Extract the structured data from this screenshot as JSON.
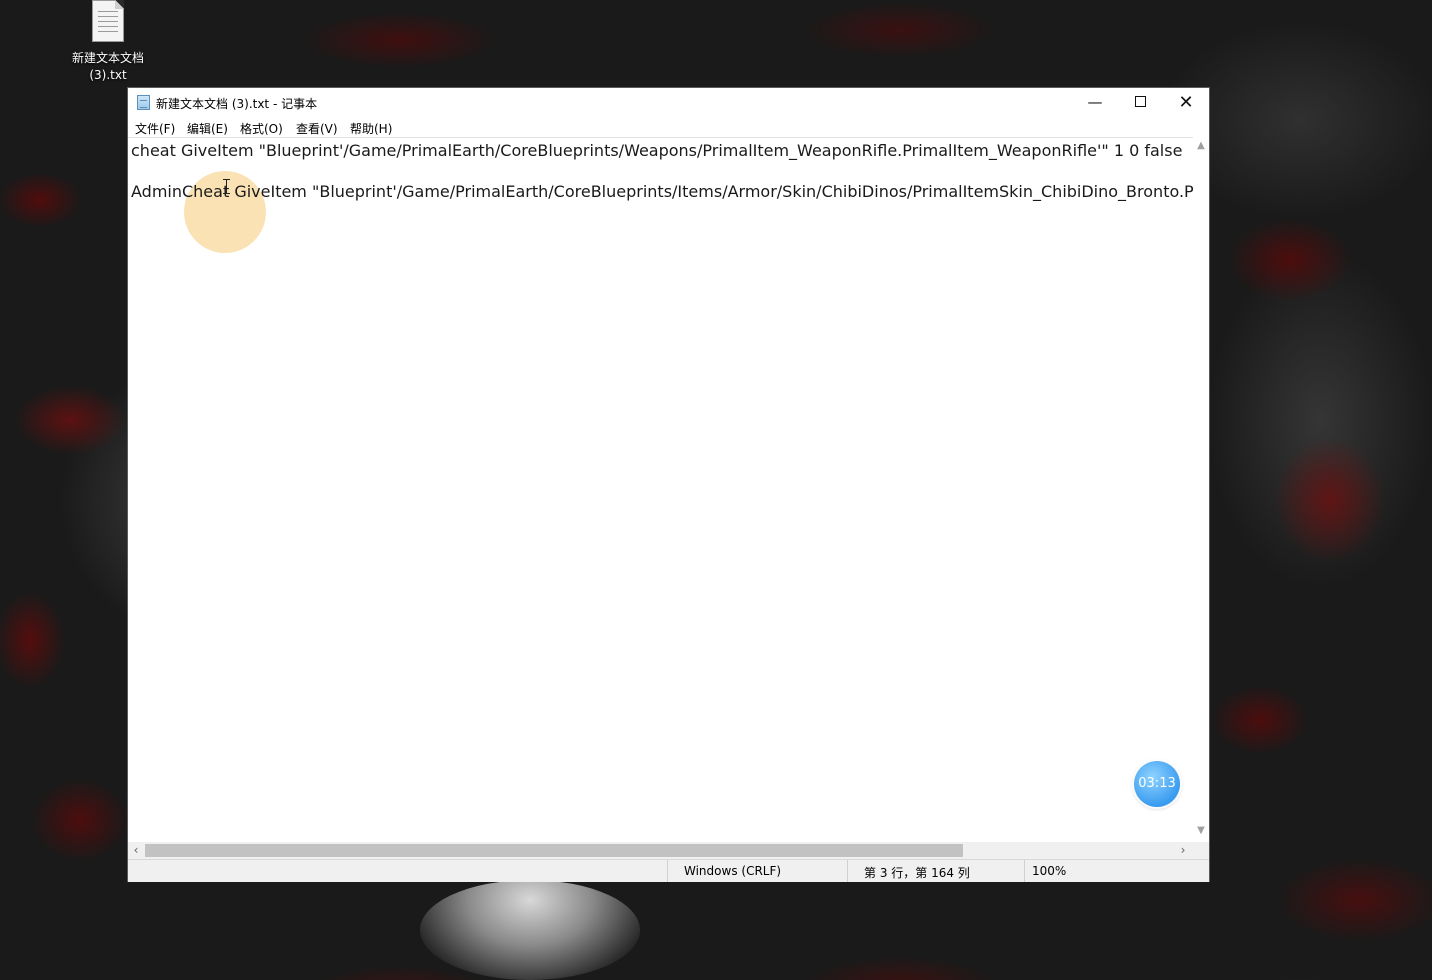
{
  "desktop": {
    "icon_label_line1": "新建文本文档",
    "icon_label_line2": "(3).txt"
  },
  "window": {
    "title": "新建文本文档 (3).txt - 记事本",
    "controls": {
      "minimize": "—",
      "close": "✕"
    }
  },
  "menu": [
    {
      "label": "文件(F)"
    },
    {
      "label": "编辑(E)"
    },
    {
      "label": "格式(O)"
    },
    {
      "label": "查看(V)"
    },
    {
      "label": "帮助(H)"
    }
  ],
  "editor": {
    "lines": [
      "cheat GiveItem \"Blueprint'/Game/PrimalEarth/CoreBlueprints/Weapons/PrimalItem_WeaponRifle.PrimalItem_WeaponRifle'\" 1 0 false",
      "",
      "AdminCheat GiveItem \"Blueprint'/Game/PrimalEarth/CoreBlueprints/Items/Armor/Skin/ChibiDinos/PrimalItemSkin_ChibiDino_Bronto.Prima"
    ]
  },
  "statusbar": {
    "encoding": "Windows (CRLF)",
    "position": "第 3 行，第 164 列",
    "zoom": "100%"
  },
  "overlay": {
    "timer": "03:13"
  },
  "colors": {
    "timer_blue": "#3a9cf0",
    "click_halo": "#f8d28c"
  }
}
